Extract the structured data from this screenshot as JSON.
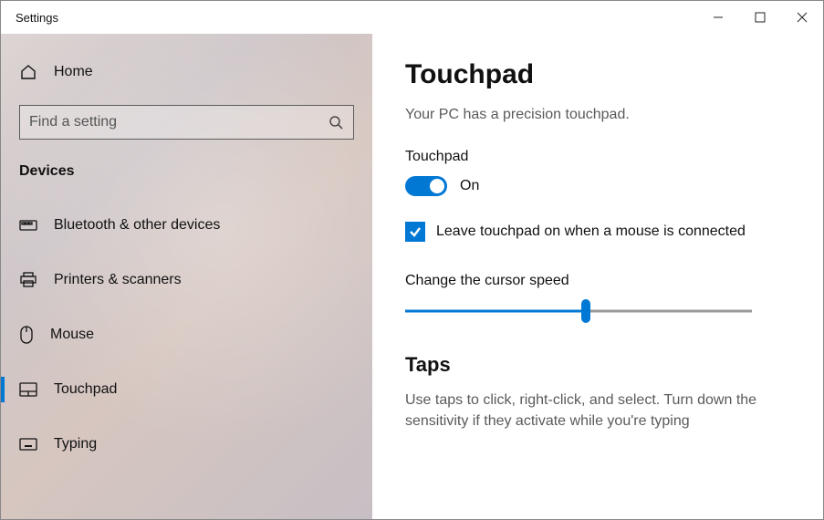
{
  "window": {
    "title": "Settings"
  },
  "sidebar": {
    "home": "Home",
    "search_placeholder": "Find a setting",
    "category": "Devices",
    "items": [
      {
        "label": "Bluetooth & other devices"
      },
      {
        "label": "Printers & scanners"
      },
      {
        "label": "Mouse"
      },
      {
        "label": "Touchpad"
      },
      {
        "label": "Typing"
      }
    ]
  },
  "main": {
    "title": "Touchpad",
    "subtitle": "Your PC has a precision touchpad.",
    "toggle_section_label": "Touchpad",
    "toggle_state_text": "On",
    "checkbox_label": "Leave touchpad on when a mouse is connected",
    "slider_label": "Change the cursor speed",
    "taps_title": "Taps",
    "taps_body": "Use taps to click, right-click, and select. Turn down the sensitivity if they activate while you're typing"
  }
}
